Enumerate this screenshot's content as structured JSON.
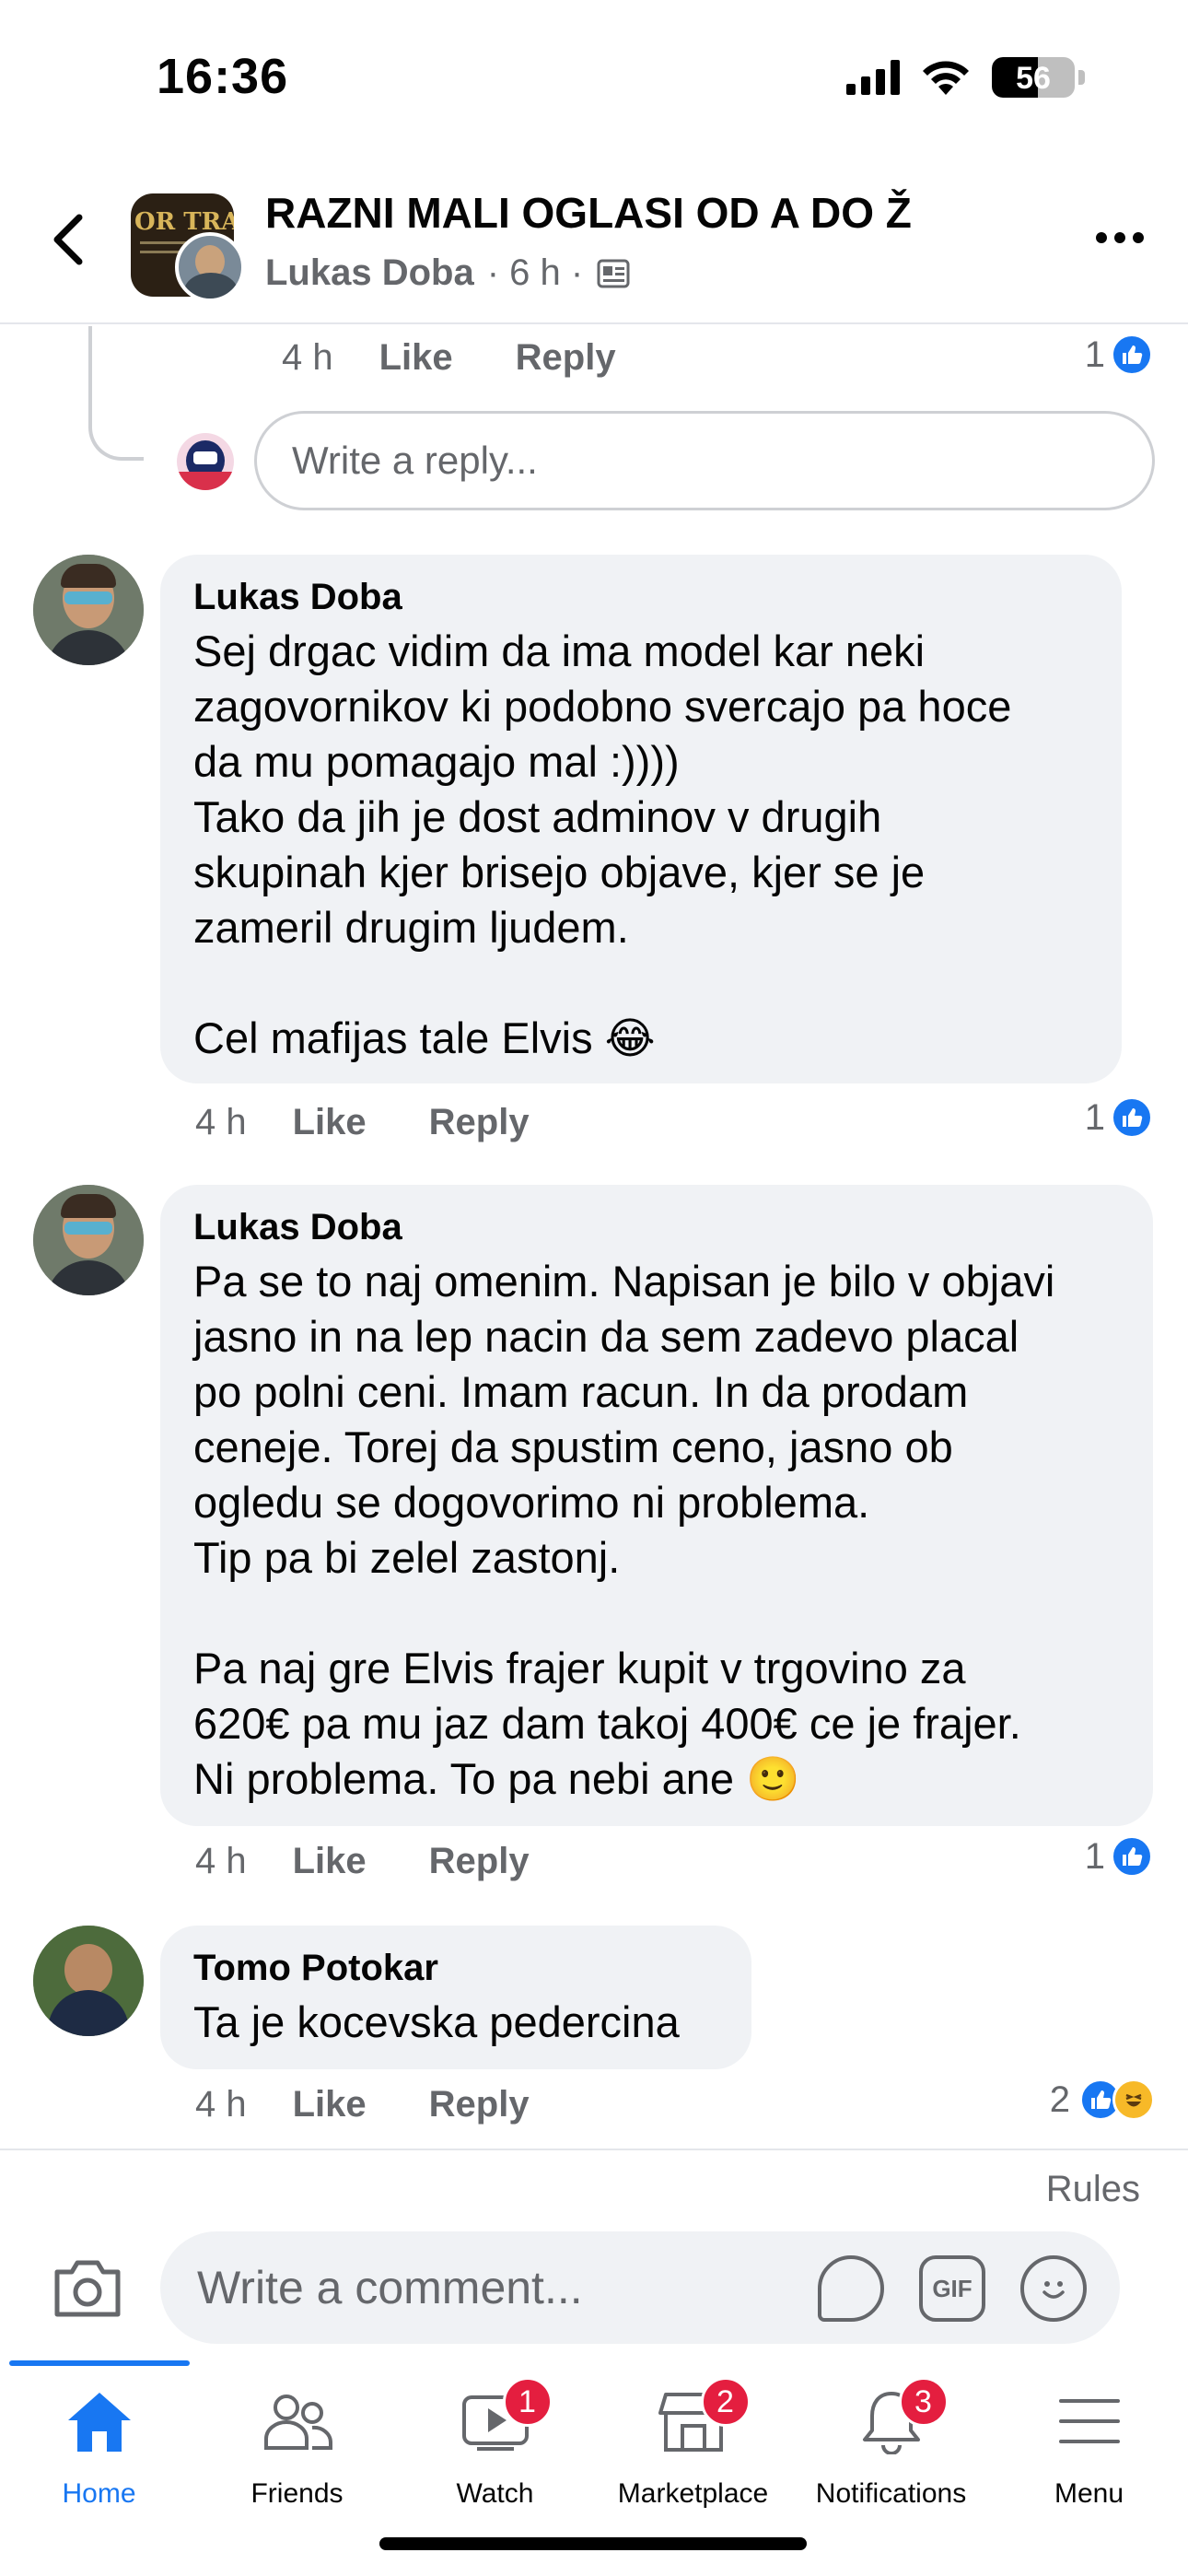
{
  "status_bar": {
    "time": "16:36",
    "battery": "56"
  },
  "header": {
    "group_title": "RAZNI MALI OGLASI OD A DO Ž",
    "group_logo_text": "OR TRADE",
    "poster": "Lukas Doba",
    "time": "· 6 h ·"
  },
  "prev_reply": {
    "time": "4 h",
    "like": "Like",
    "reply": "Reply",
    "reaction_count": "1"
  },
  "reply_box": {
    "placeholder": "Write a reply..."
  },
  "comments": [
    {
      "author": "Lukas Doba",
      "text": "Sej drgac vidim da ima model kar neki\nzagovornikov ki podobno svercajo pa hoce\nda mu pomagajo mal :))))\nTako da jih je dost adminov v drugih\nskupinah kjer brisejo objave, kjer se je\nzameril drugim ljudem.\n\nCel mafijas tale Elvis 😂",
      "time": "4 h",
      "like": "Like",
      "reply": "Reply",
      "reaction_count": "1"
    },
    {
      "author": "Lukas Doba",
      "text": "Pa se to naj omenim. Napisan je bilo v objavi\njasno in na lep nacin da sem zadevo placal\npo polni ceni. Imam racun. In da prodam\nceneje. Torej da spustim ceno, jasno ob\nogledu se dogovorimo ni problema.\nTip pa bi zelel zastonj.\n\nPa naj gre Elvis frajer kupit v trgovino za\n620€ pa mu jaz dam takoj 400€ ce je frajer.\nNi problema. To pa nebi ane 🙂",
      "time": "4 h",
      "like": "Like",
      "reply": "Reply",
      "reaction_count": "1"
    },
    {
      "author": "Tomo Potokar",
      "text": "Ta je kocevska pedercina",
      "time": "4 h",
      "like": "Like",
      "reply": "Reply",
      "reaction_count": "2"
    }
  ],
  "composer": {
    "rules": "Rules",
    "placeholder": "Write a comment...",
    "gif": "GIF"
  },
  "tabs": [
    {
      "label": "Home",
      "icon": "home-icon",
      "badge": ""
    },
    {
      "label": "Friends",
      "icon": "friends-icon",
      "badge": ""
    },
    {
      "label": "Watch",
      "icon": "watch-icon",
      "badge": "1"
    },
    {
      "label": "Marketplace",
      "icon": "marketplace-icon",
      "badge": "2"
    },
    {
      "label": "Notifications",
      "icon": "bell-icon",
      "badge": "3"
    },
    {
      "label": "Menu",
      "icon": "menu-icon",
      "badge": ""
    }
  ],
  "colors": {
    "accent": "#1877f2",
    "badge": "#e41e3f",
    "bubble": "#f0f2f5",
    "secondary_text": "#65676b"
  }
}
